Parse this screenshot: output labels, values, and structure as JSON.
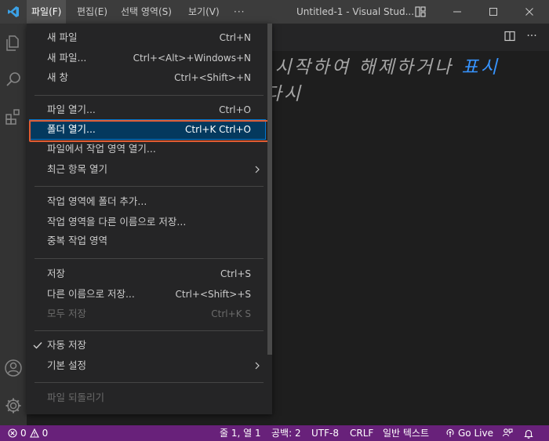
{
  "titlebar": {
    "menus": [
      "파일(F)",
      "편집(E)",
      "선택 영역(S)",
      "보기(V)",
      "···"
    ],
    "window_title": "Untitled-1 - Visual Stud..."
  },
  "editor": {
    "hint_line_1": "을 시작하여 해제하거나 ",
    "hint_link": "표시",
    "hint_line_2": "- 다시"
  },
  "file_menu": {
    "new_file": {
      "label": "새 파일",
      "shortcut": "Ctrl+N"
    },
    "new_file_ellipsis": {
      "label": "새 파일...",
      "shortcut": "Ctrl+<Alt>+Windows+N"
    },
    "new_window": {
      "label": "새 창",
      "shortcut": "Ctrl+<Shift>+N"
    },
    "open_file": {
      "label": "파일 열기...",
      "shortcut": "Ctrl+O"
    },
    "open_folder": {
      "label": "폴더 열기...",
      "shortcut": "Ctrl+K Ctrl+O"
    },
    "open_workspace_from_file": {
      "label": "파일에서 작업 영역 열기..."
    },
    "open_recent": {
      "label": "최근 항목 열기"
    },
    "add_folder_to_workspace": {
      "label": "작업 영역에 폴더 추가..."
    },
    "save_workspace_as": {
      "label": "작업 영역을 다른 이름으로 저장..."
    },
    "duplicate_workspace": {
      "label": "중복 작업 영역"
    },
    "save": {
      "label": "저장",
      "shortcut": "Ctrl+S"
    },
    "save_as": {
      "label": "다른 이름으로 저장...",
      "shortcut": "Ctrl+<Shift>+S"
    },
    "save_all": {
      "label": "모두 저장",
      "shortcut": "Ctrl+K S"
    },
    "auto_save": {
      "label": "자동 저장",
      "checked": true
    },
    "preferences": {
      "label": "기본 설정"
    },
    "revert_file": {
      "label": "파일 되돌리기"
    }
  },
  "statusbar": {
    "errors": "0",
    "warnings": "0",
    "position": "줄 1, 열 1",
    "indent": "공백: 2",
    "encoding": "UTF-8",
    "eol": "CRLF",
    "language": "일반 텍스트",
    "golive": "Go Live"
  },
  "colors": {
    "statusbar_bg": "#68217a",
    "menu_bg": "#252526",
    "highlight_bg": "#04395e",
    "focus_outline": "#e05c33",
    "link": "#3794ff"
  }
}
